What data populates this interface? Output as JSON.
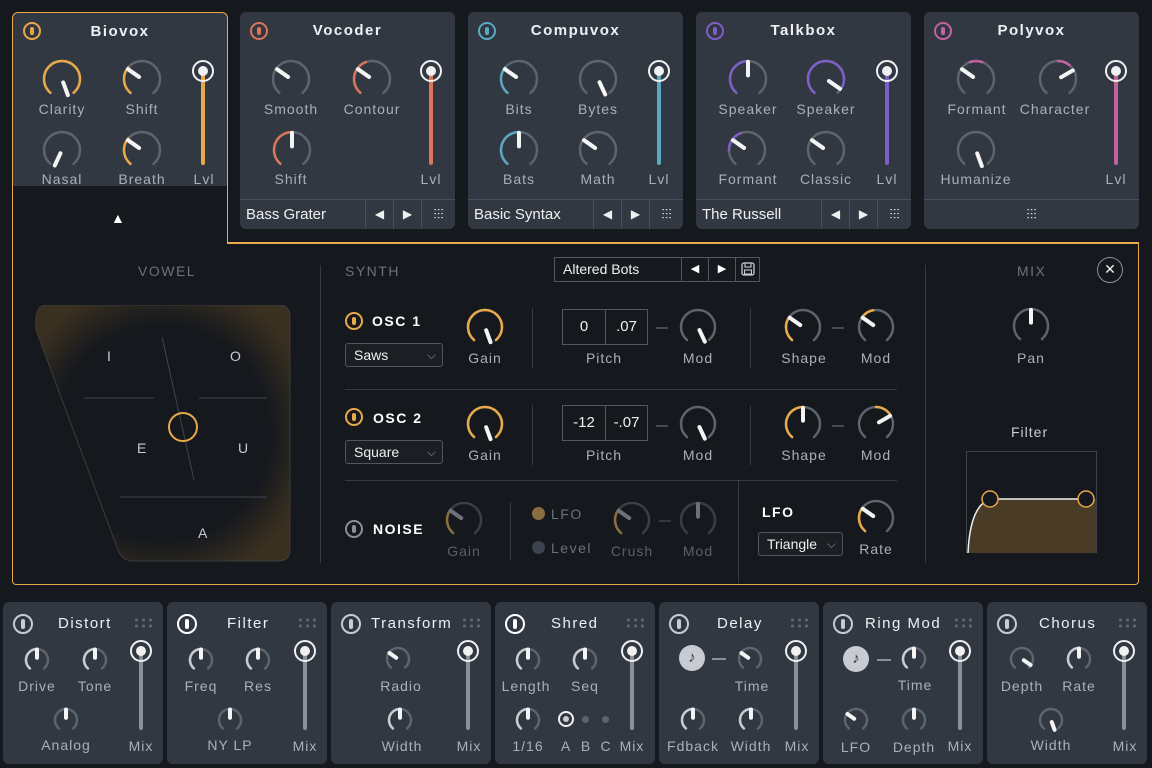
{
  "colors": {
    "biovox": "#e8a94a",
    "vocoder": "#d97558",
    "compuvox": "#5aa8c2",
    "talkbox": "#7d5fc8",
    "polyvox": "#c462a0",
    "accent": "#e8a94a",
    "neutral": "#c8ccd2"
  },
  "modules": [
    {
      "name": "Biovox",
      "knobs": [
        "Clarity",
        "Shift",
        "Nasal",
        "Breath"
      ],
      "level_label": "Lvl",
      "selected": true
    },
    {
      "name": "Vocoder",
      "knobs": [
        "Smooth",
        "Contour",
        "Shift"
      ],
      "level_label": "Lvl",
      "preset": "Bass Grater"
    },
    {
      "name": "Compuvox",
      "knobs": [
        "Bits",
        "Bytes",
        "Bats",
        "Math"
      ],
      "level_label": "Lvl",
      "preset": "Basic Syntax"
    },
    {
      "name": "Talkbox",
      "knobs": [
        "Speaker",
        "Speaker",
        "Formant",
        "Classic"
      ],
      "level_label": "Lvl",
      "preset": "The Russell"
    },
    {
      "name": "Polyvox",
      "knobs": [
        "Formant",
        "Character",
        "Humanize"
      ],
      "level_label": "Lvl"
    }
  ],
  "icons": {
    "prev": "◀",
    "next": "▶",
    "mixer": "⫶",
    "collapse": "▲",
    "close": "✕",
    "save": "💾",
    "note": "♪",
    "chevron": "⌄"
  },
  "vowel": {
    "label": "VOWEL",
    "letters": {
      "i": "I",
      "o": "O",
      "e": "E",
      "u": "U",
      "a": "A"
    }
  },
  "synth": {
    "label": "SYNTH",
    "preset": "Altered Bots",
    "osc1": {
      "label": "OSC 1",
      "wave": "Saws",
      "gain": "Gain",
      "pitch_label": "Pitch",
      "pitch_semi": "0",
      "pitch_fine": ".07",
      "mod": "Mod",
      "shape": "Shape",
      "shape_mod": "Mod"
    },
    "osc2": {
      "label": "OSC 2",
      "wave": "Square",
      "gain": "Gain",
      "pitch_label": "Pitch",
      "pitch_semi": "-12",
      "pitch_fine": "-.07",
      "mod": "Mod",
      "shape": "Shape",
      "shape_mod": "Mod"
    },
    "noise": {
      "label": "NOISE",
      "gain": "Gain",
      "lfo_option": "LFO",
      "level_option": "Level",
      "crush": "Crush",
      "mod": "Mod"
    },
    "lfo": {
      "label": "LFO",
      "shape": "Triangle",
      "rate": "Rate"
    }
  },
  "mix": {
    "label": "MIX",
    "pan": "Pan",
    "filter": "Filter"
  },
  "effects": [
    {
      "name": "Distort",
      "knobs": [
        "Drive",
        "Tone",
        "Analog"
      ],
      "mix": "Mix"
    },
    {
      "name": "Filter",
      "knobs": [
        "Freq",
        "Res",
        "NY LP"
      ],
      "mix": "Mix"
    },
    {
      "name": "Transform",
      "knobs": [
        "Radio",
        "Width"
      ],
      "mix": "Mix"
    },
    {
      "name": "Shred",
      "knobs": [
        "Length",
        "Seq",
        "1/16"
      ],
      "patterns": [
        "A",
        "B",
        "C"
      ],
      "mix": "Mix"
    },
    {
      "name": "Delay",
      "knobs": [
        "Time",
        "Fdback",
        "Width"
      ],
      "mix": "Mix"
    },
    {
      "name": "Ring Mod",
      "knobs": [
        "Time",
        "LFO",
        "Depth"
      ],
      "mix": "Mix"
    },
    {
      "name": "Chorus",
      "knobs": [
        "Depth",
        "Rate",
        "Width"
      ],
      "mix": "Mix"
    }
  ]
}
